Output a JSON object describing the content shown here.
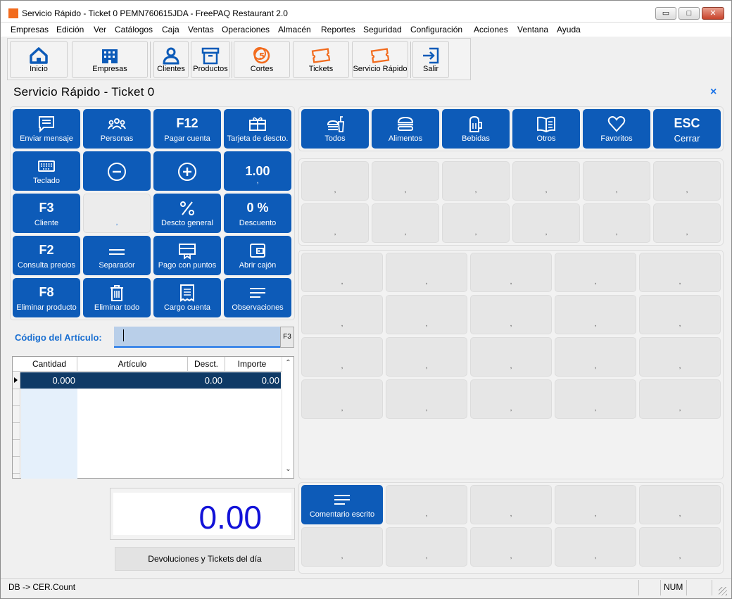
{
  "window": {
    "title": "Servicio Rápido - Ticket 0 PEMN760615JDA - FreePAQ Restaurant 2.0",
    "min_glyph": "▭",
    "max_glyph": "□",
    "close_glyph": "✕"
  },
  "menu": [
    "Empresas",
    "Edición",
    "Ver",
    "Catálogos",
    "Caja",
    "Ventas",
    "Operaciones",
    "Almacén",
    "Reportes",
    "Seguridad",
    "Configuración",
    "Acciones",
    "Ventana",
    "Ayuda"
  ],
  "toolbar": {
    "inicio": "Inicio",
    "empresas": "Empresas",
    "clientes": "Clientes",
    "productos": "Productos",
    "cortes": "Cortes",
    "tickets": "Tickets",
    "servicio": "Servicio Rápido",
    "salir": "Salir"
  },
  "panel": {
    "title": "Servicio Rápido - Ticket 0",
    "close": "×"
  },
  "actions": {
    "enviar": "Enviar mensaje",
    "personas": "Personas",
    "f12_key": "F12",
    "pagar": "Pagar cuenta",
    "tarjeta": "Tarjeta de descto.",
    "teclado": "Teclado",
    "qty_value": "1.00",
    "qty_sub": ",",
    "f3_key": "F3",
    "cliente": "Cliente",
    "empty_sub": ",",
    "descto_general": "Descto general",
    "descuento_value": "0 %",
    "descuento": "Descuento",
    "f2_key": "F2",
    "consulta": "Consulta precios",
    "separador": "Separador",
    "pago_puntos": "Pago con puntos",
    "abrir_cajon": "Abrir cajón",
    "f8_key": "F8",
    "eliminar_producto": "Eliminar producto",
    "eliminar_todo": "Eliminar todo",
    "cargo_cuenta": "Cargo cuenta",
    "observaciones": "Observaciones"
  },
  "categories": {
    "todos": "Todos",
    "alimentos": "Alimentos",
    "bebidas": "Bebidas",
    "otros": "Otros",
    "favoritos": "Favoritos",
    "esc_key": "ESC",
    "cerrar": "Cerrar"
  },
  "empty_label": ",",
  "codigo": {
    "label": "Código del Artículo:",
    "value": "",
    "f3": "F3"
  },
  "grid": {
    "headers": [
      "Cantidad",
      "Artículo",
      "Desct.",
      "Importe"
    ],
    "row": {
      "cantidad": "0.000",
      "articulo": "",
      "desct": "0.00",
      "importe": "0.00"
    }
  },
  "total": "0.00",
  "devoluciones": "Devoluciones y Tickets del día",
  "comentario": "Comentario escrito",
  "status": {
    "left": "DB -> CER.Count",
    "num": "NUM"
  },
  "colors": {
    "accent": "#0d5bb8",
    "total": "#1212d8",
    "app_icon": "#f26b1d"
  }
}
